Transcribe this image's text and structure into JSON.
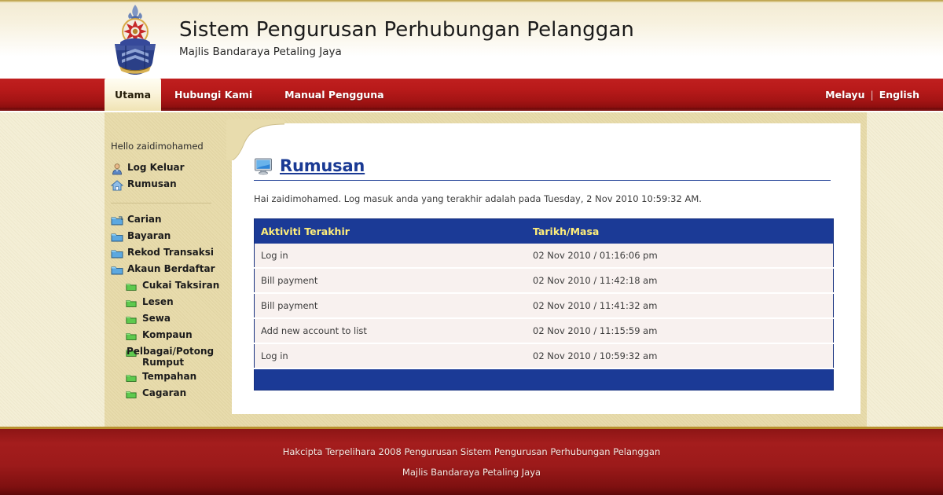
{
  "header": {
    "title": "Sistem Pengurusan Perhubungan Pelanggan",
    "subtitle": "Majlis Bandaraya Petaling Jaya",
    "logo_icon": "mbpj-coat-of-arms-icon"
  },
  "nav": {
    "active_tab": "Utama",
    "links": [
      "Hubungi Kami",
      "Manual Pengguna"
    ],
    "lang_primary": "Melayu",
    "lang_separator": "|",
    "lang_secondary": "English"
  },
  "sidebar": {
    "greeting": "Hello zaidimohamed",
    "account_items": [
      {
        "label": "Log Keluar",
        "icon": "user-icon"
      },
      {
        "label": "Rumusan",
        "icon": "home-icon"
      }
    ],
    "menu_items": [
      {
        "label": "Carian",
        "icon": "blue-folder-icon"
      },
      {
        "label": "Bayaran",
        "icon": "blue-folder-icon"
      },
      {
        "label": "Rekod Transaksi",
        "icon": "blue-folder-icon"
      },
      {
        "label": "Akaun Berdaftar",
        "icon": "blue-folder-icon"
      }
    ],
    "sub_items": [
      {
        "label": "Cukai Taksiran",
        "icon": "green-folder-icon"
      },
      {
        "label": "Lesen",
        "icon": "green-folder-icon"
      },
      {
        "label": "Sewa",
        "icon": "green-folder-icon"
      },
      {
        "label": "Kompaun",
        "icon": "green-folder-icon"
      },
      {
        "label": "Pelbagai/Potong Rumput",
        "icon": "green-folder-icon"
      },
      {
        "label": "Tempahan",
        "icon": "green-folder-icon"
      },
      {
        "label": "Cagaran",
        "icon": "green-folder-icon"
      }
    ]
  },
  "content": {
    "panel_icon": "monitor-icon",
    "panel_title": "Rumusan",
    "greeting": "Hai zaidimohamed. Log masuk anda yang terakhir adalah pada Tuesday, 2 Nov 2010 10:59:32 AM.",
    "table": {
      "headers": [
        "Aktiviti Terakhir",
        "Tarikh/Masa"
      ],
      "rows": [
        [
          "Log in",
          "02 Nov 2010 / 01:16:06 pm"
        ],
        [
          "Bill payment",
          "02 Nov 2010 / 11:42:18 am"
        ],
        [
          "Bill payment",
          "02 Nov 2010 / 11:41:32 am"
        ],
        [
          "Add new account to list",
          "02 Nov 2010 / 11:15:59 am"
        ],
        [
          "Log in",
          "02 Nov 2010 / 10:59:32 am"
        ]
      ]
    }
  },
  "footer": {
    "line1": "Hakcipta Terpelihara 2008 Pengurusan Sistem Pengurusan Perhubungan Pelanggan",
    "line2": "Majlis Bandaraya Petaling Jaya"
  },
  "colors": {
    "nav_red": "#b81a1a",
    "footer_red": "#9c1a1a",
    "table_header_blue": "#1b3a96",
    "table_header_text": "#ffee7a",
    "panel_title_blue": "#1a3a94",
    "sidebar_tan": "#e8dcad",
    "row_bg": "#f8f1ef",
    "gold_rule": "#b9912f"
  }
}
